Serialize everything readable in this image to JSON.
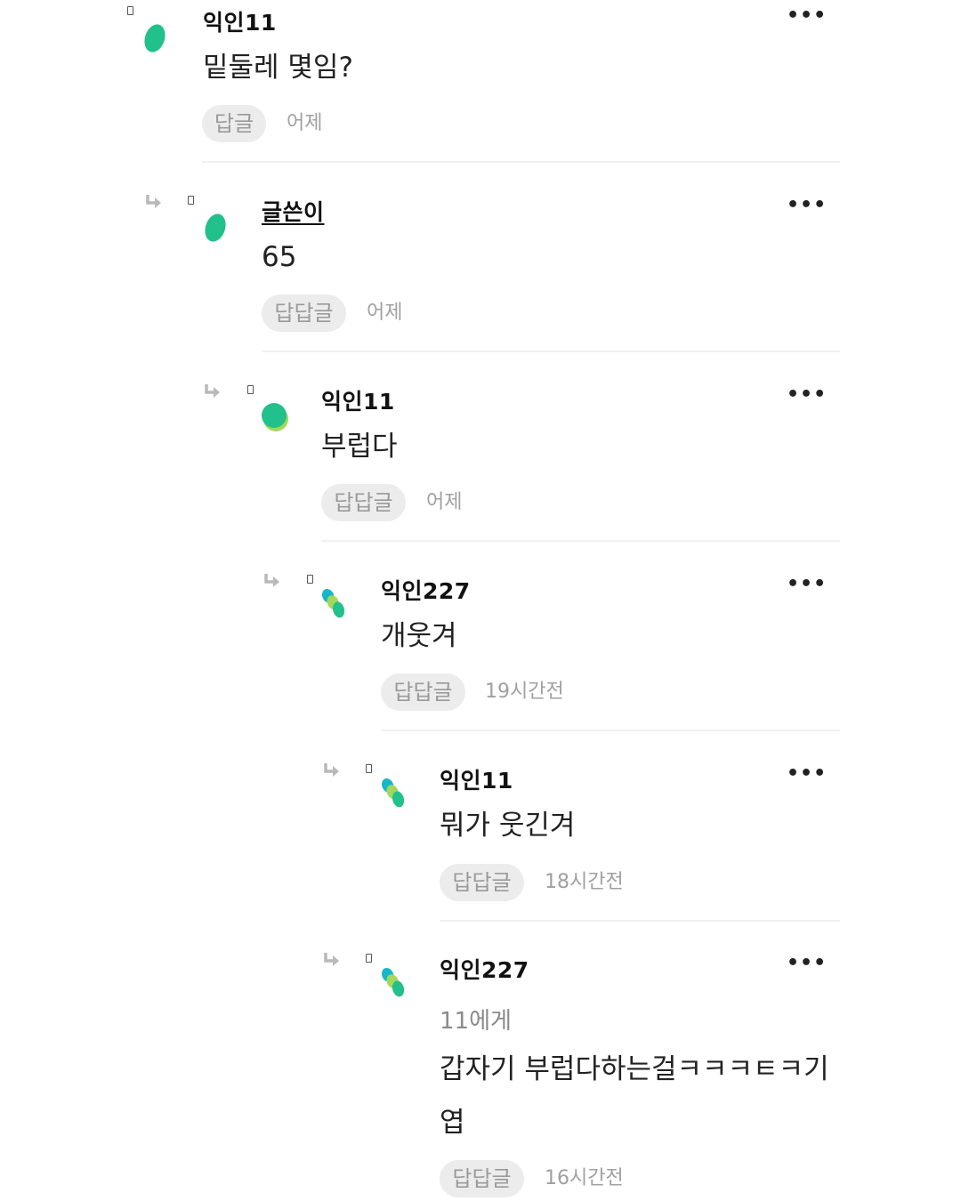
{
  "colors": {
    "avatar_green": "#22c08a",
    "avatar_teal": "#17b6c8",
    "avatar_lime": "#a4d85a",
    "button_bg": "#ececec",
    "muted_text": "#9a9a9a"
  },
  "icons": {
    "reply_arrow": "reply-arrow-icon",
    "more": "more-options-icon",
    "avatar": "anonymous-avatar-icon"
  },
  "comments": [
    {
      "author": "익인11",
      "text": "밑둘레 몇임?",
      "reply_label": "답글",
      "time": "어제"
    },
    {
      "author": "글쓴이",
      "text": "65",
      "reply_label": "답답글",
      "time": "어제"
    },
    {
      "author": "익인11",
      "text": "부럽다",
      "reply_label": "답답글",
      "time": "어제"
    },
    {
      "author": "익인227",
      "text": "개웃겨",
      "reply_label": "답답글",
      "time": "19시간전"
    },
    {
      "author": "익인11",
      "text": "뭐가 웃긴겨",
      "reply_label": "답답글",
      "time": "18시간전"
    },
    {
      "author": "익인227",
      "mention": "11에게",
      "text_line1": "갑자기 부럽다하는걸ㅋㅋㅋㅌㅋ기",
      "text_line2": "엽",
      "reply_label": "답답글",
      "time": "16시간전"
    }
  ]
}
